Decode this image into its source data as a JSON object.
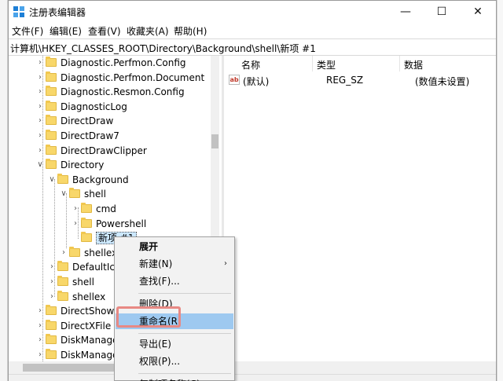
{
  "window": {
    "title": "注册表编辑器",
    "minimize": "—",
    "maximize": "☐",
    "close": "✕"
  },
  "menu": [
    "文件(F)",
    "编辑(E)",
    "查看(V)",
    "收藏夹(A)",
    "帮助(H)"
  ],
  "address": "计算机\\HKEY_CLASSES_ROOT\\Directory\\Background\\shell\\新项 #1",
  "tree": [
    {
      "label": "Diagnostic.Perfmon.Config",
      "level": 0,
      "expander": "chevron-right"
    },
    {
      "label": "Diagnostic.Perfmon.Document",
      "level": 0,
      "expander": "chevron-right"
    },
    {
      "label": "Diagnostic.Resmon.Config",
      "level": 0,
      "expander": "chevron-right"
    },
    {
      "label": "DiagnosticLog",
      "level": 0,
      "expander": "chevron-right"
    },
    {
      "label": "DirectDraw",
      "level": 0,
      "expander": "chevron-right"
    },
    {
      "label": "DirectDraw7",
      "level": 0,
      "expander": "chevron-right"
    },
    {
      "label": "DirectDrawClipper",
      "level": 0,
      "expander": "chevron-right"
    },
    {
      "label": "Directory",
      "level": 0,
      "expander": "chevron-down"
    },
    {
      "label": "Background",
      "level": 1,
      "expander": "chevron-down"
    },
    {
      "label": "shell",
      "level": 2,
      "expander": "chevron-down"
    },
    {
      "label": "cmd",
      "level": 3,
      "expander": "chevron-right"
    },
    {
      "label": "Powershell",
      "level": 3,
      "expander": "chevron-right"
    },
    {
      "label": "新项 #1",
      "level": 3,
      "expander": "none",
      "selected": true
    },
    {
      "label": "shellex",
      "level": 2,
      "expander": "chevron-right"
    },
    {
      "label": "DefaultIco",
      "level": 1,
      "expander": "chevron-right"
    },
    {
      "label": "shell",
      "level": 1,
      "expander": "chevron-right"
    },
    {
      "label": "shellex",
      "level": 1,
      "expander": "chevron-right"
    },
    {
      "label": "DirectShow",
      "level": 0,
      "expander": "chevron-right"
    },
    {
      "label": "DirectXFile",
      "level": 0,
      "expander": "chevron-right"
    },
    {
      "label": "DiskManage",
      "level": 0,
      "expander": "chevron-right"
    },
    {
      "label": "DiskManage",
      "level": 0,
      "expander": "chevron-right"
    }
  ],
  "list": {
    "headers": [
      "名称",
      "类型",
      "数据"
    ],
    "rows": [
      {
        "icon": "string-value-icon",
        "icon_text": "ab",
        "name": "(默认)",
        "type": "REG_SZ",
        "data": "(数值未设置)"
      }
    ]
  },
  "context_menu": {
    "items": [
      {
        "label": "展开",
        "bold": true
      },
      {
        "label": "新建(N)",
        "submenu": true
      },
      {
        "label": "查找(F)..."
      },
      {
        "separator": true
      },
      {
        "label": "删除(D)"
      },
      {
        "label": "重命名(R)",
        "highlighted": true
      },
      {
        "separator": true
      },
      {
        "label": "导出(E)"
      },
      {
        "label": "权限(P)..."
      },
      {
        "separator": true
      },
      {
        "label": "复制项名称(C)"
      }
    ],
    "submenu_arrow": "›"
  },
  "colors": {
    "accent_highlight": "#9ec9f0",
    "annotation_box": "#e88984",
    "folder": "#f8d76a",
    "tree_selection": "#cce8ff"
  }
}
